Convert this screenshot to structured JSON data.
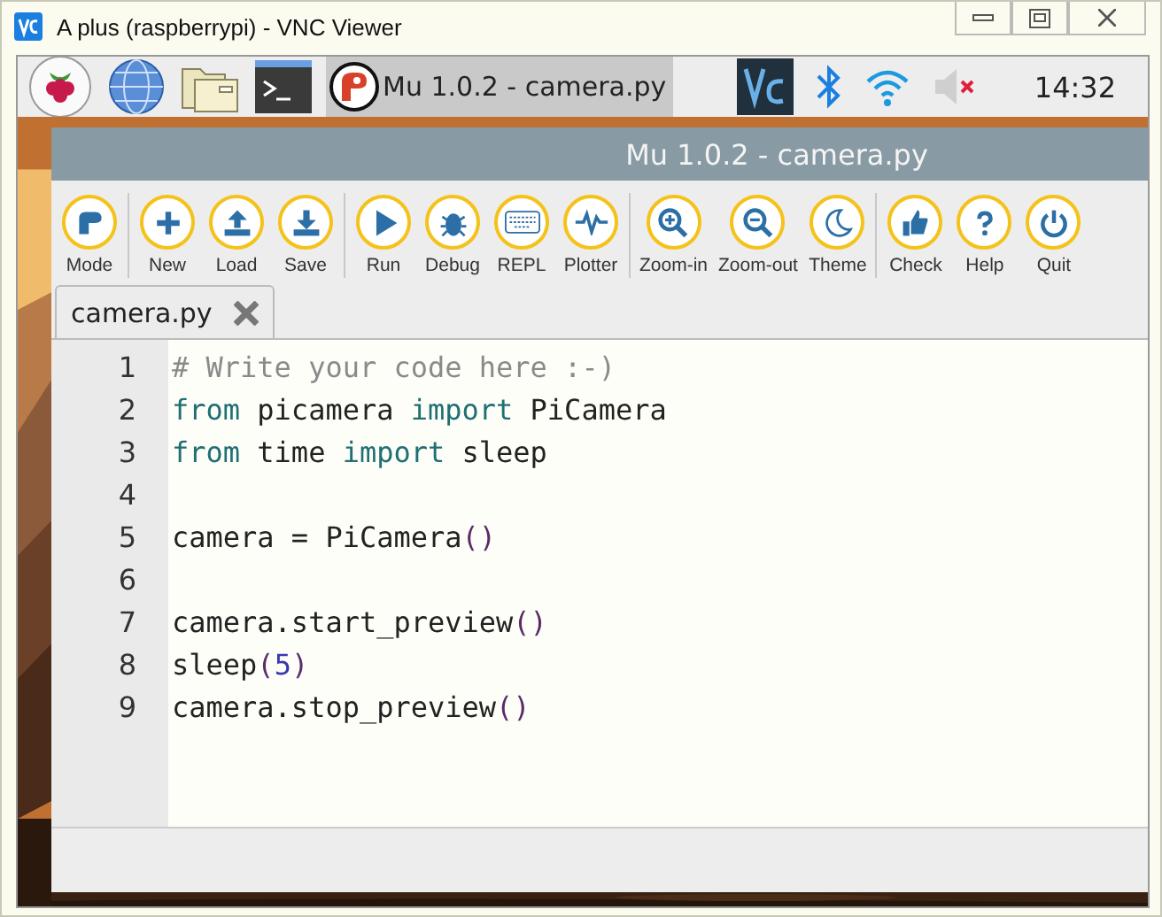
{
  "window": {
    "title": "A plus (raspberrypi) - VNC Viewer"
  },
  "taskbar": {
    "task": {
      "label": "Mu 1.0.2 - camera.py",
      "selected": true
    },
    "clock": "14:32"
  },
  "mu": {
    "title": "Mu 1.0.2 - camera.py",
    "toolbar": [
      [
        {
          "label": "Mode"
        }
      ],
      [
        {
          "label": "New"
        },
        {
          "label": "Load"
        },
        {
          "label": "Save"
        }
      ],
      [
        {
          "label": "Run"
        },
        {
          "label": "Debug"
        },
        {
          "label": "REPL"
        },
        {
          "label": "Plotter"
        }
      ],
      [
        {
          "label": "Zoom-in"
        },
        {
          "label": "Zoom-out"
        },
        {
          "label": "Theme"
        }
      ],
      [
        {
          "label": "Check"
        },
        {
          "label": "Help"
        },
        {
          "label": "Quit"
        }
      ]
    ],
    "tabs": [
      {
        "label": "camera.py",
        "selected": true
      }
    ],
    "editor": {
      "lines": [
        {
          "number": "1",
          "tokens": [
            {
              "kind": "comment",
              "text": "# Write your code here :-)"
            }
          ]
        },
        {
          "number": "2",
          "tokens": [
            {
              "kind": "keyword",
              "text": "from"
            },
            {
              "kind": "plain",
              "text": " picamera "
            },
            {
              "kind": "keyword",
              "text": "import"
            },
            {
              "kind": "plain",
              "text": " PiCamera"
            }
          ]
        },
        {
          "number": "3",
          "tokens": [
            {
              "kind": "keyword",
              "text": "from"
            },
            {
              "kind": "plain",
              "text": " time "
            },
            {
              "kind": "keyword",
              "text": "import"
            },
            {
              "kind": "plain",
              "text": " sleep"
            }
          ]
        },
        {
          "number": "4"
        },
        {
          "number": "5",
          "tokens": [
            {
              "kind": "plain",
              "text": "camera = PiCamera"
            },
            {
              "kind": "paren",
              "text": "()"
            }
          ]
        },
        {
          "number": "6"
        },
        {
          "number": "7",
          "tokens": [
            {
              "kind": "plain",
              "text": "camera.start_preview"
            },
            {
              "kind": "paren",
              "text": "()"
            }
          ]
        },
        {
          "number": "8",
          "tokens": [
            {
              "kind": "plain",
              "text": "sleep"
            },
            {
              "kind": "paren",
              "text": "("
            },
            {
              "kind": "number",
              "text": "5"
            },
            {
              "kind": "paren",
              "text": ")"
            }
          ]
        },
        {
          "number": "9",
          "tokens": [
            {
              "kind": "plain",
              "text": "camera.stop_preview"
            },
            {
              "kind": "paren",
              "text": "()"
            }
          ]
        }
      ]
    }
  }
}
